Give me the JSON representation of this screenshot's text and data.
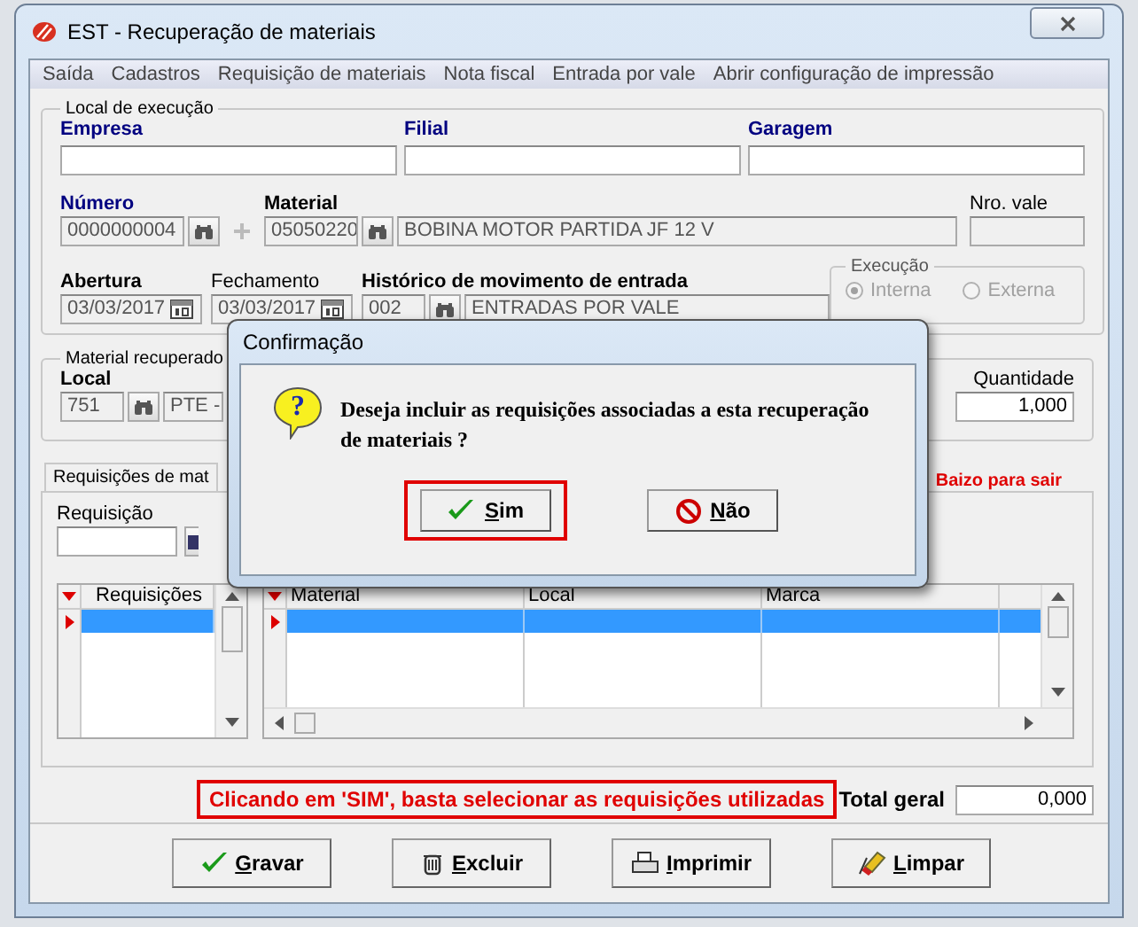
{
  "window": {
    "title": "EST - Recuperação de materiais"
  },
  "menu": [
    "Saída",
    "Cadastros",
    "Requisição de materiais",
    "Nota fiscal",
    "Entrada por vale",
    "Abrir configuração de impressão"
  ],
  "local_execucao": {
    "legend": "Local de execução",
    "top_fields": [
      {
        "label": "Empresa",
        "kind": "required",
        "disabled": false
      },
      {
        "label": "Filial",
        "kind": "required",
        "disabled": false
      },
      {
        "label": "Garagem",
        "kind": "required",
        "disabled": false
      }
    ],
    "numero": {
      "label": "Número",
      "kind": "required",
      "value": "0000000004",
      "disabled": true
    },
    "material": {
      "label": "Material",
      "kind": "bold",
      "code": "05050220",
      "description": "BOBINA MOTOR PARTIDA JF 12 V",
      "disabled": true
    },
    "nro_vale": {
      "label": "Nro. vale",
      "kind": "plain",
      "disabled": true
    },
    "abertura": {
      "label": "Abertura",
      "kind": "bold",
      "value": "03/03/2017",
      "disabled": true
    },
    "fechamento": {
      "label": "Fechamento",
      "kind": "plain",
      "value": "03/03/2017",
      "disabled": true
    },
    "historico": {
      "label": "Histórico de movimento de entrada",
      "kind": "bold",
      "code": "002",
      "description": "ENTRADAS POR VALE",
      "disabled": true
    },
    "execucao": {
      "legend": "Execução",
      "disabled": true,
      "options": [
        {
          "label": "Interna",
          "selected": true
        },
        {
          "label": "Externa",
          "selected": false
        }
      ]
    }
  },
  "material_recuperado": {
    "legend": "Material recuperado",
    "local": {
      "label": "Local",
      "kind": "bold",
      "code": "751",
      "description": "PTE -",
      "disabled": true
    },
    "quantidade": {
      "label": "Quantidade",
      "kind": "plain",
      "value": "1,000",
      "disabled": false
    }
  },
  "requisicoes": {
    "tab": "Requisições de mat",
    "hint": "Baizo para sair",
    "requisicao": {
      "label": "Requisição",
      "kind": "plain",
      "disabled": false
    },
    "list": {
      "columns": [
        "Requisições"
      ]
    },
    "grid": {
      "columns": [
        "Material",
        "Local",
        "Marca"
      ]
    }
  },
  "note": "Clicando em 'SIM', basta selecionar as requisições utilizadas",
  "total": {
    "label": "Total geral",
    "value": "0,000",
    "disabled": false
  },
  "buttons": [
    {
      "label": "Gravar",
      "kind": "save"
    },
    {
      "label": "Excluir",
      "kind": "delete"
    },
    {
      "label": "Imprimir",
      "kind": "print"
    },
    {
      "label": "Limpar",
      "kind": "clear"
    }
  ],
  "dialog": {
    "title": "Confirmação",
    "icon_glyph": "?",
    "message": "Deseja incluir as requisições associadas a esta recuperação de materiais ?",
    "buttons": [
      {
        "label": "Sim",
        "kind": "yes",
        "annotated": true
      },
      {
        "label": "Não",
        "kind": "no",
        "annotated": false
      }
    ]
  }
}
